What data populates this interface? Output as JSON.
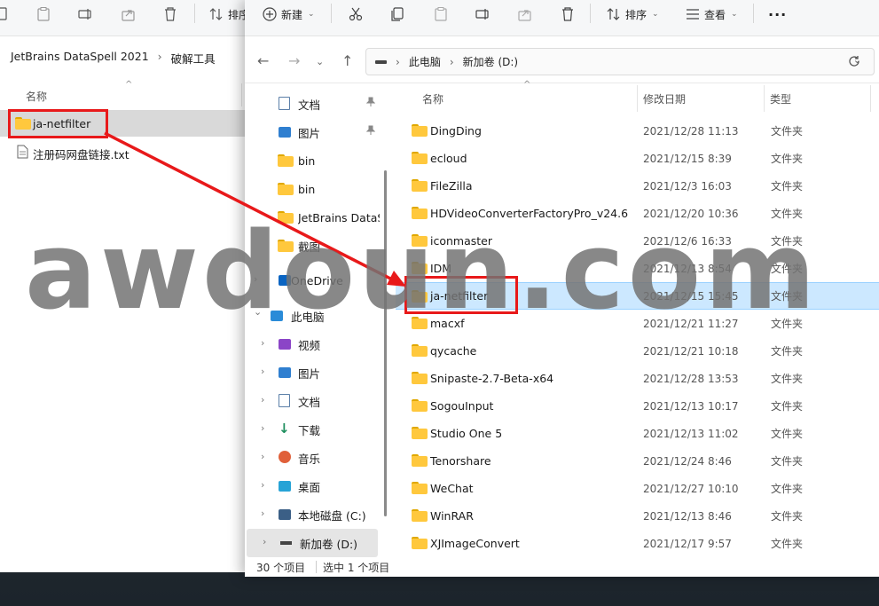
{
  "back_window": {
    "toolbar": {
      "sort_label_partial": "排序"
    },
    "breadcrumb": [
      "JetBrains DataSpell 2021",
      "破解工具"
    ],
    "column_name": "名称",
    "files": [
      {
        "name": "ja-netfilter",
        "type": "folder"
      },
      {
        "name": "注册码网盘链接.txt",
        "type": "text"
      }
    ]
  },
  "front_window": {
    "toolbar": {
      "new_label": "新建",
      "sort_label": "排序",
      "view_label": "查看",
      "more": "···"
    },
    "address": {
      "segments": [
        "此电脑",
        "新加卷 (D:)"
      ]
    },
    "columns": {
      "name": "名称",
      "date": "修改日期",
      "type": "类型"
    },
    "sidebar": [
      {
        "label": "文档",
        "icon": "document-icon",
        "pinned": true
      },
      {
        "label": "图片",
        "icon": "picture-icon",
        "pinned": true
      },
      {
        "label": "bin",
        "icon": "folder-icon"
      },
      {
        "label": "bin",
        "icon": "folder-icon"
      },
      {
        "label": "JetBrains DataS",
        "icon": "folder-icon"
      },
      {
        "label": "截图",
        "icon": "folder-icon"
      },
      {
        "label": "OneDrive",
        "icon": "cloud-icon",
        "expander": true
      },
      {
        "label": "此电脑",
        "icon": "computer-icon",
        "expanded": true
      },
      {
        "label": "视频",
        "icon": "video-icon",
        "expander": true
      },
      {
        "label": "图片",
        "icon": "picture-icon",
        "expander": true
      },
      {
        "label": "文档",
        "icon": "document-icon",
        "expander": true
      },
      {
        "label": "下载",
        "icon": "download-icon",
        "expander": true
      },
      {
        "label": "音乐",
        "icon": "music-icon",
        "expander": true
      },
      {
        "label": "桌面",
        "icon": "desktop-icon",
        "expander": true
      },
      {
        "label": "本地磁盘 (C:)",
        "icon": "drive-c-icon",
        "expander": true
      },
      {
        "label": "新加卷 (D:)",
        "icon": "drive-icon",
        "expander": true,
        "selected": true
      }
    ],
    "files": [
      {
        "name": "DingDing",
        "date": "2021/12/28 11:13",
        "type": "文件夹"
      },
      {
        "name": "ecloud",
        "date": "2021/12/15 8:39",
        "type": "文件夹"
      },
      {
        "name": "FileZilla",
        "date": "2021/12/3 16:03",
        "type": "文件夹"
      },
      {
        "name": "HDVideoConverterFactoryPro_v24.6",
        "date": "2021/12/20 10:36",
        "type": "文件夹"
      },
      {
        "name": "iconmaster",
        "date": "2021/12/6 16:33",
        "type": "文件夹"
      },
      {
        "name": "IDM",
        "date": "2021/12/13 8:54",
        "type": "文件夹"
      },
      {
        "name": "ja-netfilter",
        "date": "2021/12/15 15:45",
        "type": "文件夹",
        "selected": true
      },
      {
        "name": "macxf",
        "date": "2021/12/21 11:27",
        "type": "文件夹"
      },
      {
        "name": "qycache",
        "date": "2021/12/21 10:18",
        "type": "文件夹"
      },
      {
        "name": "Snipaste-2.7-Beta-x64",
        "date": "2021/12/28 13:53",
        "type": "文件夹"
      },
      {
        "name": "SogouInput",
        "date": "2021/12/13 10:17",
        "type": "文件夹"
      },
      {
        "name": "Studio One 5",
        "date": "2021/12/13 11:02",
        "type": "文件夹"
      },
      {
        "name": "Tenorshare",
        "date": "2021/12/24 8:46",
        "type": "文件夹"
      },
      {
        "name": "WeChat",
        "date": "2021/12/27 10:10",
        "type": "文件夹"
      },
      {
        "name": "WinRAR",
        "date": "2021/12/13 8:46",
        "type": "文件夹"
      },
      {
        "name": "XJImageConvert",
        "date": "2021/12/17 9:57",
        "type": "文件夹"
      }
    ],
    "status": {
      "count": "30 个项目",
      "selected": "选中 1 个项目"
    }
  },
  "overlay": {
    "watermark": "awdoun.com",
    "annotation_color": "#e8191a"
  },
  "colors": {
    "selection": "#cce8ff",
    "folder": "#ffc83d",
    "accent": "#0067c0"
  }
}
